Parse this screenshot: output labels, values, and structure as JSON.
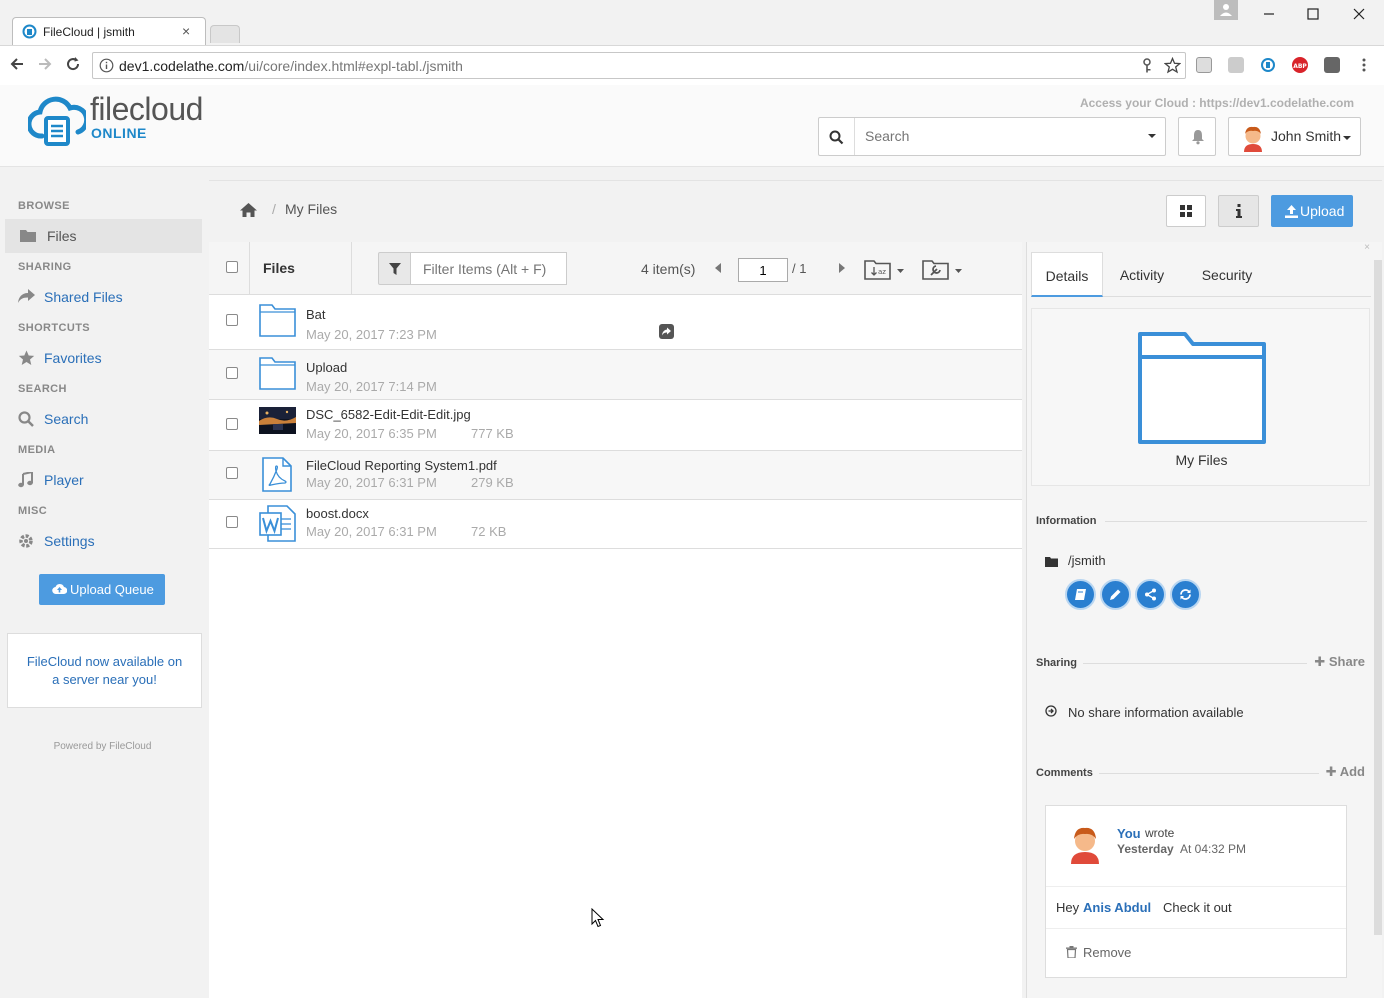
{
  "browser": {
    "tab_title": "FileCloud | jsmith",
    "tab_close": "×",
    "url_host": "dev1.codelathe.com",
    "url_path": "/ui/core/index.html#expl-tabl./jsmith"
  },
  "header": {
    "logo_text": "filecloud",
    "logo_sub": "ONLINE",
    "access_text": "Access your Cloud : https://dev1.codelathe.com",
    "search_placeholder": "Search",
    "user_name": "John Smith"
  },
  "sidebar": {
    "sections": [
      {
        "heading": "BROWSE",
        "item": "Files"
      },
      {
        "heading": "SHARING",
        "item": "Shared Files"
      },
      {
        "heading": "SHORTCUTS",
        "item": "Favorites"
      },
      {
        "heading": "SEARCH",
        "item": "Search"
      },
      {
        "heading": "MEDIA",
        "item": "Player"
      },
      {
        "heading": "MISC",
        "item": "Settings"
      }
    ],
    "upload_queue": "Upload Queue",
    "promo_line1": "FileCloud now available on",
    "promo_line2": "a server near you!",
    "powered": "Powered by FileCloud"
  },
  "breadcrumb": {
    "separator": "/",
    "current": "My Files"
  },
  "actions": {
    "upload": "Upload"
  },
  "toolbar": {
    "column_files": "Files",
    "filter_placeholder": "Filter Items (Alt + F)",
    "item_count": "4 item(s)",
    "page_current": "1",
    "page_total": "/ 1"
  },
  "files": [
    {
      "name": "Bat",
      "date": "May 20, 2017 7:23 PM",
      "size": "",
      "type": "folder",
      "shared": true
    },
    {
      "name": "Upload",
      "date": "May 20, 2017 7:14 PM",
      "size": "",
      "type": "folder"
    },
    {
      "name": "DSC_6582-Edit-Edit-Edit.jpg",
      "date": "May 20, 2017 6:35 PM",
      "size": "777 KB",
      "type": "image"
    },
    {
      "name": "FileCloud Reporting System1.pdf",
      "date": "May 20, 2017 6:31 PM",
      "size": "279 KB",
      "type": "pdf"
    },
    {
      "name": "boost.docx",
      "date": "May 20, 2017 6:31 PM",
      "size": "72 KB",
      "type": "docx"
    }
  ],
  "details": {
    "tabs": [
      "Details",
      "Activity",
      "Security"
    ],
    "preview_label": "My Files",
    "information_heading": "Information",
    "path": "/jsmith",
    "sharing_heading": "Sharing",
    "share_action": "Share",
    "no_share": "No share information available",
    "comments_heading": "Comments",
    "add_action": "Add",
    "comment": {
      "author": "You",
      "wrote": "wrote",
      "time_day": "Yesterday",
      "time_rest": "At 04:32 PM",
      "text_before": "Hey",
      "mention": "Anis Abdul",
      "text_after": "Check it out",
      "remove": "Remove"
    }
  },
  "colors": {
    "accent": "#4d9be0",
    "link": "#2a6fb8",
    "brand": "#1e88c9"
  }
}
